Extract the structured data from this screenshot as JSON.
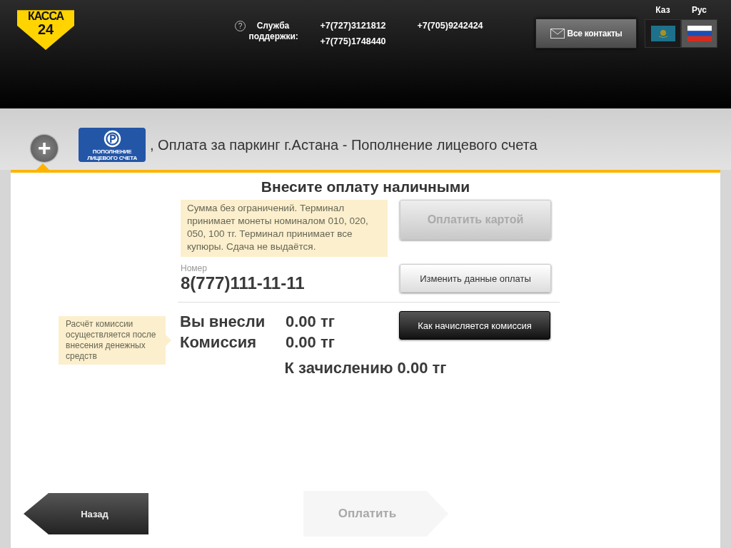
{
  "header": {
    "logo": {
      "line1": "КАССА",
      "line2": "24"
    },
    "support": {
      "icon": "?",
      "label": "Служба поддержки:",
      "phones": [
        "+7(727)3121812",
        "+7(775)1748440",
        "+7(705)9242424"
      ]
    },
    "contacts_button": "Все контакты",
    "languages": [
      {
        "label": "Каз",
        "kind": "kz",
        "selected": false
      },
      {
        "label": "Рус",
        "kind": "ru",
        "selected": true
      }
    ]
  },
  "service": {
    "add_icon": "+",
    "badge_caption": [
      "ПОПОЛНЕНИЕ",
      "ЛИЦЕВОГО СЧЕТА"
    ],
    "title": ", Оплата за паркинг г.Астана - Пополнение лицевого счета"
  },
  "payment": {
    "heading": "Внесите оплату наличными",
    "notice": "Сумма без ограничений. Терминал принимает монеты номиналом 010, 020, 050, 100 тг. Терминал принимает все купюры. Сдача не выдаётся.",
    "card_button": {
      "label": "Оплатить картой",
      "disabled": true
    },
    "number_label": "Номер",
    "number": "8(777)111-11-11",
    "change_button": "Изменить данные оплаты",
    "amounts": [
      {
        "label": "Вы внесли",
        "value": "0.00 тг"
      },
      {
        "label": "Комиссия",
        "value": "0.00 тг"
      }
    ],
    "commission_button": "Как начисляется комиссия",
    "commission_tip": "Расчёт комиссии осуществляется после внесения денежных средств",
    "total": "К зачислению 0.00 тг"
  },
  "footer": {
    "back_button": "Назад",
    "pay_button": {
      "label": "Оплатить",
      "disabled": true
    }
  }
}
